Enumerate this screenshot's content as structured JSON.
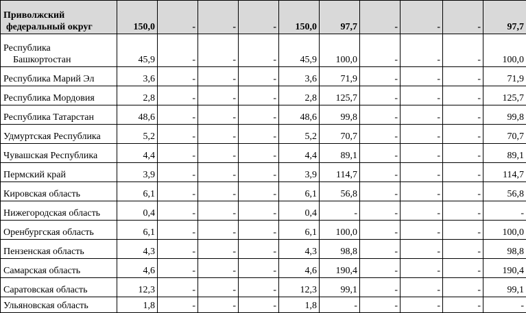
{
  "rows": [
    {
      "name_l1": "Приволжский",
      "name_l2": "федеральный округ",
      "header": true,
      "v": [
        "150,0",
        "-",
        "-",
        "-",
        "150,0",
        "97,7",
        "-",
        "-",
        "-",
        "97,7"
      ]
    },
    {
      "name_l1": "Республика",
      "name_l2": "Башкортостан",
      "v": [
        "45,9",
        "-",
        "-",
        "-",
        "45,9",
        "100,0",
        "-",
        "-",
        "-",
        "100,0"
      ]
    },
    {
      "name": "Республика Марий Эл",
      "v": [
        "3,6",
        "-",
        "-",
        "-",
        "3,6",
        "71,9",
        "-",
        "-",
        "-",
        "71,9"
      ]
    },
    {
      "name": "Республика Мордовия",
      "v": [
        "2,8",
        "-",
        "-",
        "-",
        "2,8",
        "125,7",
        "-",
        "-",
        "-",
        "125,7"
      ]
    },
    {
      "name": "Республика Татарстан",
      "v": [
        "48,6",
        "-",
        "-",
        "-",
        "48,6",
        "99,8",
        "-",
        "-",
        "-",
        "99,8"
      ]
    },
    {
      "name": "Удмуртская Республика",
      "v": [
        "5,2",
        "-",
        "-",
        "-",
        "5,2",
        "70,7",
        "-",
        "-",
        "-",
        "70,7"
      ]
    },
    {
      "name": "Чувашская Республика",
      "v": [
        "4,4",
        "-",
        "-",
        "-",
        "4,4",
        "89,1",
        "-",
        "-",
        "-",
        "89,1"
      ]
    },
    {
      "name": "Пермский край",
      "v": [
        "3,9",
        "-",
        "-",
        "-",
        "3,9",
        "114,7",
        "-",
        "-",
        "-",
        "114,7"
      ]
    },
    {
      "name": "Кировская область",
      "v": [
        "6,1",
        "-",
        "-",
        "-",
        "6,1",
        "56,8",
        "-",
        "-",
        "-",
        "56,8"
      ]
    },
    {
      "name": "Нижегородская область",
      "v": [
        "0,4",
        "-",
        "-",
        "-",
        "0,4",
        "-",
        "-",
        "-",
        "-",
        "-"
      ]
    },
    {
      "name": "Оренбургская область",
      "v": [
        "6,1",
        "-",
        "-",
        "-",
        "6,1",
        "100,0",
        "-",
        "-",
        "-",
        "100,0"
      ]
    },
    {
      "name": "Пензенская область",
      "v": [
        "4,3",
        "-",
        "-",
        "-",
        "4,3",
        "98,8",
        "-",
        "-",
        "-",
        "98,8"
      ]
    },
    {
      "name": "Самарская область",
      "v": [
        "4,6",
        "-",
        "-",
        "-",
        "4,6",
        "190,4",
        "-",
        "-",
        "-",
        "190,4"
      ]
    },
    {
      "name": "Саратовская область",
      "v": [
        "12,3",
        "-",
        "-",
        "-",
        "12,3",
        "99,1",
        "-",
        "-",
        "-",
        "99,1"
      ]
    },
    {
      "name": "Ульяновская область",
      "v": [
        "1,8",
        "-",
        "-",
        "-",
        "1,8",
        "-",
        "-",
        "-",
        "-",
        "-"
      ]
    }
  ]
}
